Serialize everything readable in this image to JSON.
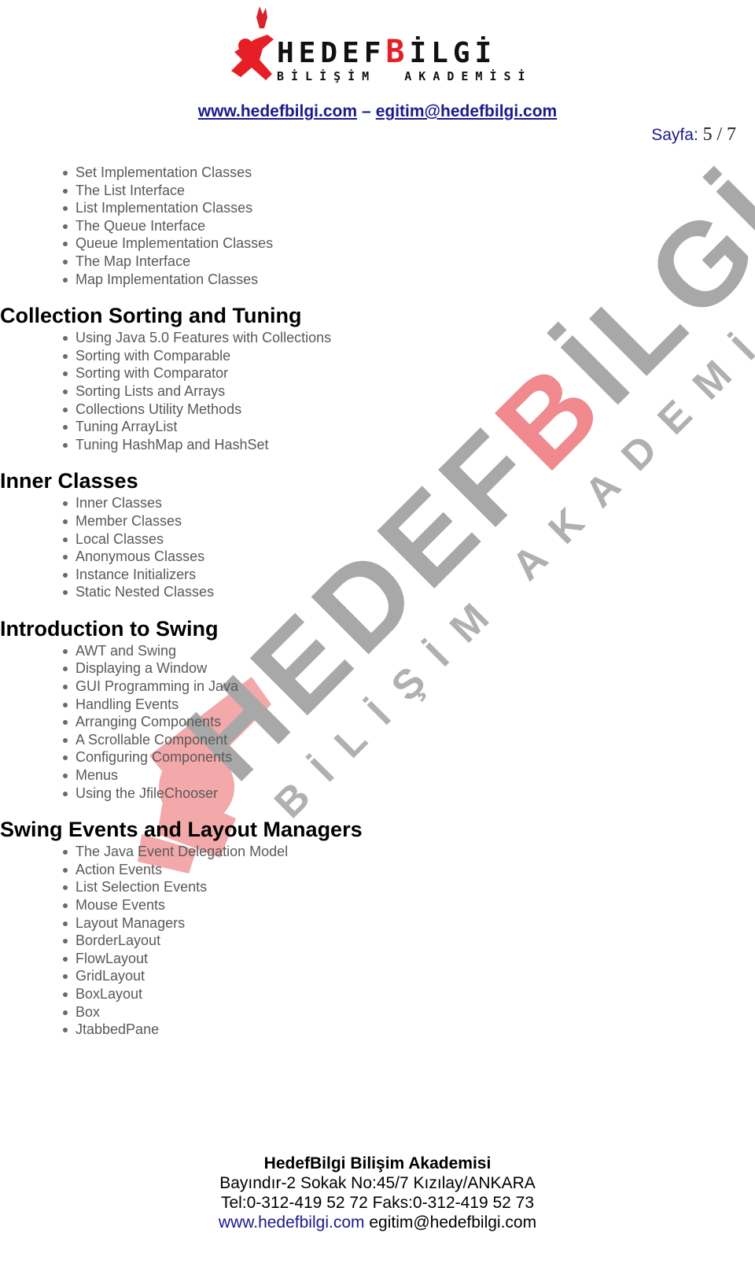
{
  "header": {
    "logo": {
      "brand_black": "HEDEF",
      "brand_red": "B",
      "brand_rest": "İLGİ",
      "subtitle": "BİLİŞİM  AKADEMİSİ",
      "icon": "running-figure-logo-icon"
    },
    "website": "www.hedefbilgi.com",
    "separator": "–",
    "email": "egitim@hedefbilgi.com",
    "page_label": "Sayfa:",
    "page_current": "5",
    "page_sep": "/",
    "page_total": "7"
  },
  "sections": [
    {
      "title": "",
      "items": [
        "Set Implementation Classes",
        "The List Interface",
        "List Implementation Classes",
        "The Queue Interface",
        "Queue Implementation Classes",
        "The Map Interface",
        "Map Implementation Classes"
      ]
    },
    {
      "title": "Collection Sorting and Tuning",
      "items": [
        "Using Java 5.0 Features with Collections",
        "Sorting with Comparable",
        "Sorting with Comparator",
        "Sorting Lists and Arrays",
        "Collections Utility Methods",
        "Tuning ArrayList",
        "Tuning HashMap and HashSet"
      ]
    },
    {
      "title": "Inner Classes",
      "items": [
        "Inner Classes",
        "Member Classes",
        "Local Classes",
        "Anonymous Classes",
        "Instance Initializers",
        "Static Nested Classes"
      ]
    },
    {
      "title": "Introduction to Swing",
      "items": [
        "AWT and Swing",
        "Displaying a Window",
        "GUI Programming in Java",
        "Handling Events",
        "Arranging Components",
        "A Scrollable Component",
        "Configuring Components",
        "Menus",
        "Using the JfileChooser"
      ]
    },
    {
      "title": "Swing Events and Layout Managers",
      "items": [
        "The Java Event Delegation Model",
        "Action Events",
        "List Selection Events",
        "Mouse Events",
        "Layout Managers",
        "BorderLayout",
        "FlowLayout",
        "GridLayout",
        "BoxLayout",
        "Box",
        "JtabbedPane"
      ]
    }
  ],
  "watermark": {
    "main_gray_1": "HEDEF",
    "main_red": "B",
    "main_gray_2": "İLGİ",
    "sub": "BİLİŞİM AKADEMİSİ"
  },
  "footer": {
    "company": "HedefBilgi Bilişim Akademisi",
    "address": "Bayındır-2 Sokak No:45/7 Kızılay/ANKARA",
    "phone": "Tel:0-312-419 52 72 Faks:0-312-419 52 73",
    "website": "www.hedefbilgi.com",
    "email": "egitim@hedefbilgi.com"
  },
  "colors": {
    "brand_red": "#e61e25",
    "link_blue": "#1a1a8c",
    "item_gray": "#595959"
  }
}
